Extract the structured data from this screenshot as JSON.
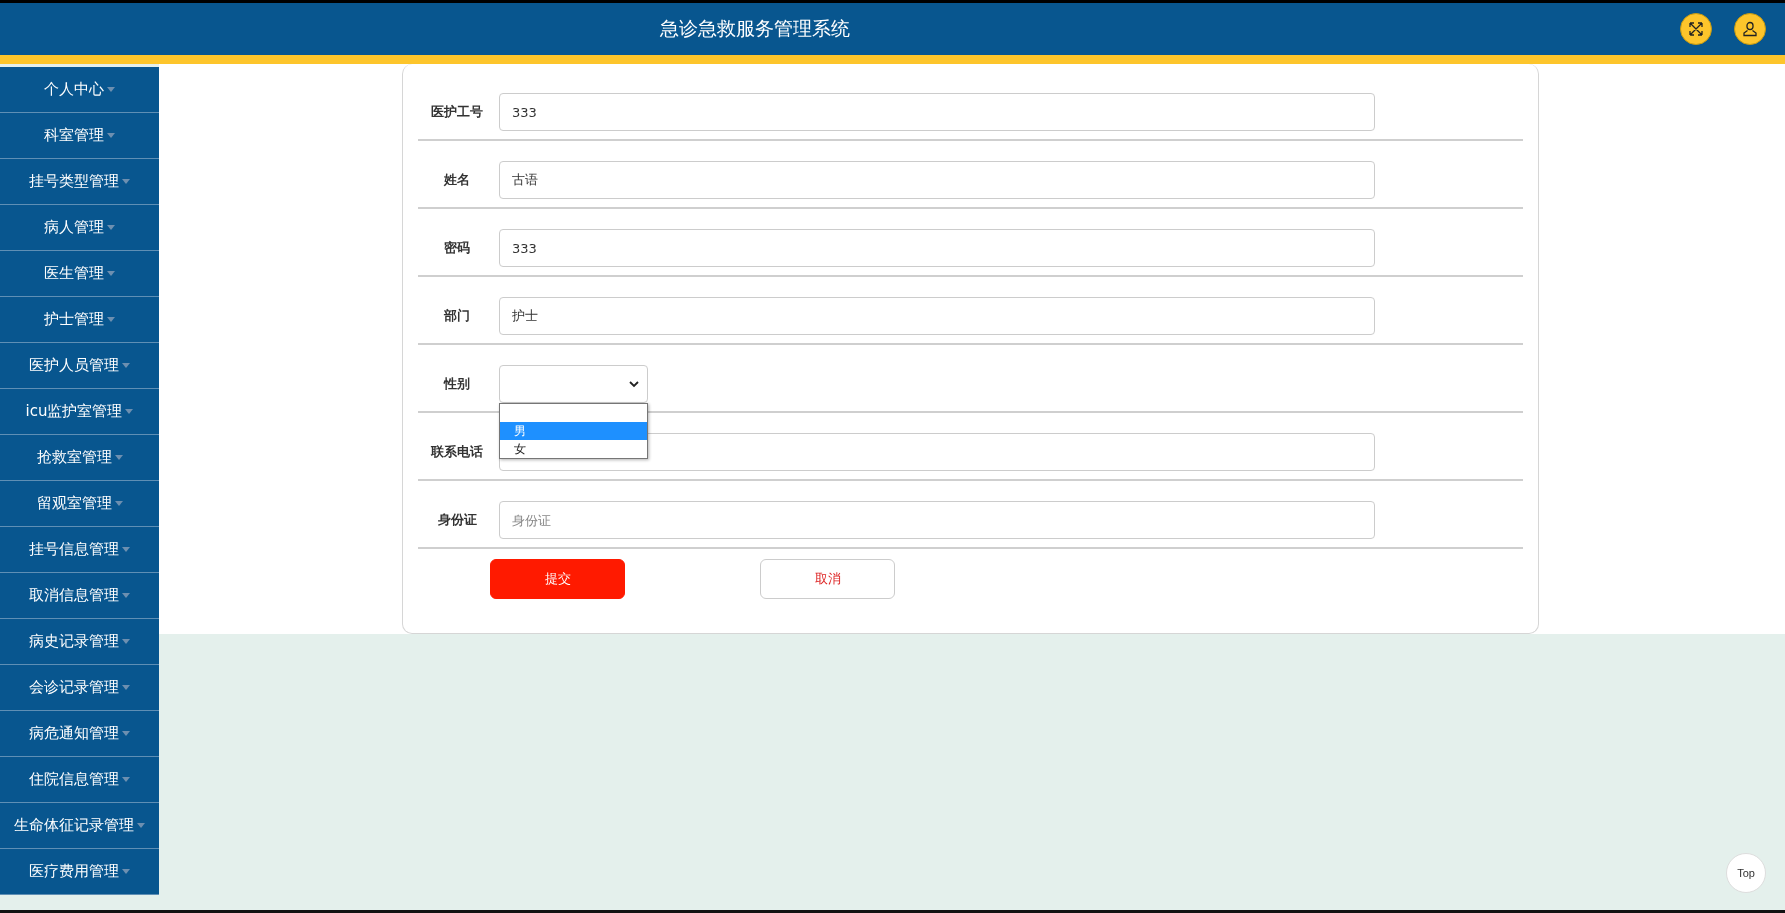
{
  "header": {
    "title": "急诊急救服务管理系统"
  },
  "sidebar": {
    "items": [
      {
        "label": "个人中心"
      },
      {
        "label": "科室管理"
      },
      {
        "label": "挂号类型管理"
      },
      {
        "label": "病人管理"
      },
      {
        "label": "医生管理"
      },
      {
        "label": "护士管理"
      },
      {
        "label": "医护人员管理"
      },
      {
        "label": "icu监护室管理"
      },
      {
        "label": "抢救室管理"
      },
      {
        "label": "留观室管理"
      },
      {
        "label": "挂号信息管理"
      },
      {
        "label": "取消信息管理"
      },
      {
        "label": "病史记录管理"
      },
      {
        "label": "会诊记录管理"
      },
      {
        "label": "病危通知管理"
      },
      {
        "label": "住院信息管理"
      },
      {
        "label": "生命体征记录管理"
      },
      {
        "label": "医疗费用管理"
      }
    ]
  },
  "form": {
    "fields": [
      {
        "label": "医护工号",
        "kind": "input",
        "value": "333"
      },
      {
        "label": "姓名",
        "kind": "input",
        "value": "古语"
      },
      {
        "label": "密码",
        "kind": "input",
        "value": "333"
      },
      {
        "label": "部门",
        "kind": "input",
        "value": "护士"
      },
      {
        "label": "性别",
        "kind": "select",
        "expanded": true,
        "options": [
          {
            "label": "男",
            "selected": true
          },
          {
            "label": "女",
            "selected": false
          }
        ]
      },
      {
        "label": "联系电话",
        "kind": "input"
      },
      {
        "label": "身份证",
        "kind": "input",
        "placeholder": "身份证"
      }
    ],
    "buttons": [
      {
        "label": "提交",
        "kind": "primary"
      },
      {
        "label": "取消",
        "kind": "secondary"
      }
    ]
  },
  "back_to_top": {
    "label": "Top"
  }
}
